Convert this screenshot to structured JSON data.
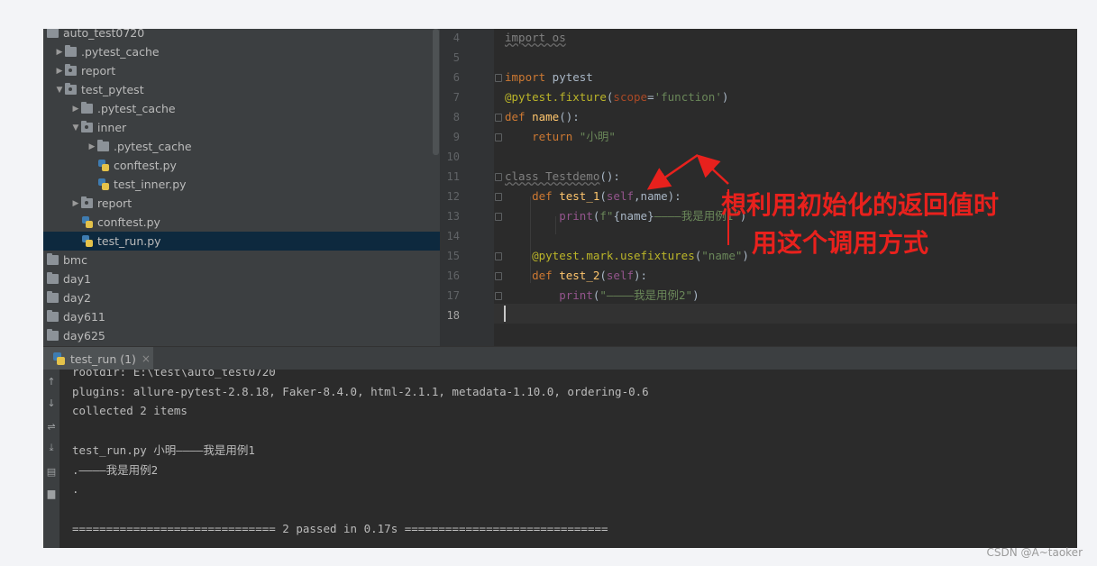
{
  "project_tree": {
    "items": [
      {
        "label": "auto_test0720",
        "kind": "folder",
        "arrow": "",
        "indent": 0
      },
      {
        "label": ".pytest_cache",
        "kind": "folder",
        "arrow": "▶",
        "indent": 1
      },
      {
        "label": "report",
        "kind": "folder",
        "arrow": "▶",
        "indent": 1
      },
      {
        "label": "test_pytest",
        "kind": "folder",
        "arrow": "▼",
        "indent": 1
      },
      {
        "label": ".pytest_cache",
        "kind": "folder",
        "arrow": "▶",
        "indent": 2
      },
      {
        "label": "inner",
        "kind": "folder",
        "arrow": "▼",
        "indent": 2
      },
      {
        "label": ".pytest_cache",
        "kind": "folder",
        "arrow": "▶",
        "indent": 3
      },
      {
        "label": "conftest.py",
        "kind": "py",
        "arrow": "",
        "indent": 3
      },
      {
        "label": "test_inner.py",
        "kind": "py",
        "arrow": "",
        "indent": 3
      },
      {
        "label": "report",
        "kind": "folder",
        "arrow": "▶",
        "indent": 2
      },
      {
        "label": "conftest.py",
        "kind": "py",
        "arrow": "",
        "indent": 2
      },
      {
        "label": "test_run.py",
        "kind": "py",
        "arrow": "",
        "indent": 2,
        "selected": true
      },
      {
        "label": "bmc",
        "kind": "folder",
        "arrow": "",
        "indent": 0
      },
      {
        "label": "day1",
        "kind": "folder",
        "arrow": "",
        "indent": 0
      },
      {
        "label": "day2",
        "kind": "folder",
        "arrow": "",
        "indent": 0
      },
      {
        "label": "day611",
        "kind": "folder",
        "arrow": "",
        "indent": 0
      },
      {
        "label": "day625",
        "kind": "folder",
        "arrow": "",
        "indent": 0
      }
    ]
  },
  "editor": {
    "line_numbers": [
      "4",
      "5",
      "6",
      "7",
      "8",
      "9",
      "10",
      "11",
      "12",
      "13",
      "14",
      "15",
      "16",
      "17",
      "18"
    ],
    "current_line": "18",
    "lines": [
      [
        {
          "t": "import os",
          "c": "dim"
        }
      ],
      [],
      [
        {
          "t": "import",
          "c": "kw"
        },
        {
          "t": " pytest",
          "c": ""
        }
      ],
      [
        {
          "t": "@pytest.fixture",
          "c": "deco"
        },
        {
          "t": "(",
          "c": ""
        },
        {
          "t": "scope",
          "c": "param"
        },
        {
          "t": "=",
          "c": ""
        },
        {
          "t": "'function'",
          "c": "str"
        },
        {
          "t": ")",
          "c": ""
        }
      ],
      [
        {
          "t": "def",
          "c": "kw"
        },
        {
          "t": " ",
          "c": ""
        },
        {
          "t": "name",
          "c": "fn"
        },
        {
          "t": "():",
          "c": ""
        }
      ],
      [
        {
          "t": "    ",
          "c": ""
        },
        {
          "t": "return",
          "c": "kw"
        },
        {
          "t": " ",
          "c": ""
        },
        {
          "t": "\"小明\"",
          "c": "str"
        }
      ],
      [],
      [
        {
          "t": "class Testdemo",
          "c": "dim"
        },
        {
          "t": "():",
          "c": ""
        }
      ],
      [
        {
          "t": "    ",
          "c": ""
        },
        {
          "t": "def",
          "c": "kw"
        },
        {
          "t": " ",
          "c": ""
        },
        {
          "t": "test_1",
          "c": "fn"
        },
        {
          "t": "(",
          "c": ""
        },
        {
          "t": "self",
          "c": "self"
        },
        {
          "t": ",",
          "c": ""
        },
        {
          "t": "name",
          "c": ""
        },
        {
          "t": "):",
          "c": ""
        }
      ],
      [
        {
          "t": "        ",
          "c": ""
        },
        {
          "t": "print",
          "c": "self"
        },
        {
          "t": "(",
          "c": ""
        },
        {
          "t": "f\"",
          "c": "str"
        },
        {
          "t": "{name}",
          "c": ""
        },
        {
          "t": "————我是用例1\"",
          "c": "str"
        },
        {
          "t": ")",
          "c": ""
        }
      ],
      [],
      [
        {
          "t": "    ",
          "c": ""
        },
        {
          "t": "@pytest.mark.usefixtures",
          "c": "deco"
        },
        {
          "t": "(",
          "c": ""
        },
        {
          "t": "\"name\"",
          "c": "str"
        },
        {
          "t": ")",
          "c": ""
        }
      ],
      [
        {
          "t": "    ",
          "c": ""
        },
        {
          "t": "def",
          "c": "kw"
        },
        {
          "t": " ",
          "c": ""
        },
        {
          "t": "test_2",
          "c": "fn"
        },
        {
          "t": "(",
          "c": ""
        },
        {
          "t": "self",
          "c": "self"
        },
        {
          "t": "):",
          "c": ""
        }
      ],
      [
        {
          "t": "        ",
          "c": ""
        },
        {
          "t": "print",
          "c": "self"
        },
        {
          "t": "(",
          "c": ""
        },
        {
          "t": "\"————我是用例2\"",
          "c": "str"
        },
        {
          "t": ")",
          "c": ""
        }
      ],
      []
    ]
  },
  "annotation": {
    "line1": "想利用初始化的返回值时",
    "line2": "用这个调用方式",
    "color": "#e8211d"
  },
  "run_panel": {
    "tab_label": "test_run (1)",
    "close_glyph": "×",
    "console_lines": [
      "rootdir: E:\\test\\auto_test0720",
      "plugins: allure-pytest-2.8.18, Faker-8.4.0, html-2.1.1, metadata-1.10.0, ordering-0.6",
      "collected 2 items",
      "",
      "test_run.py 小明————我是用例1",
      ".————我是用例2",
      ".",
      "",
      "============================== 2 passed in 0.17s =============================="
    ]
  },
  "watermark": "CSDN @A~taoker"
}
